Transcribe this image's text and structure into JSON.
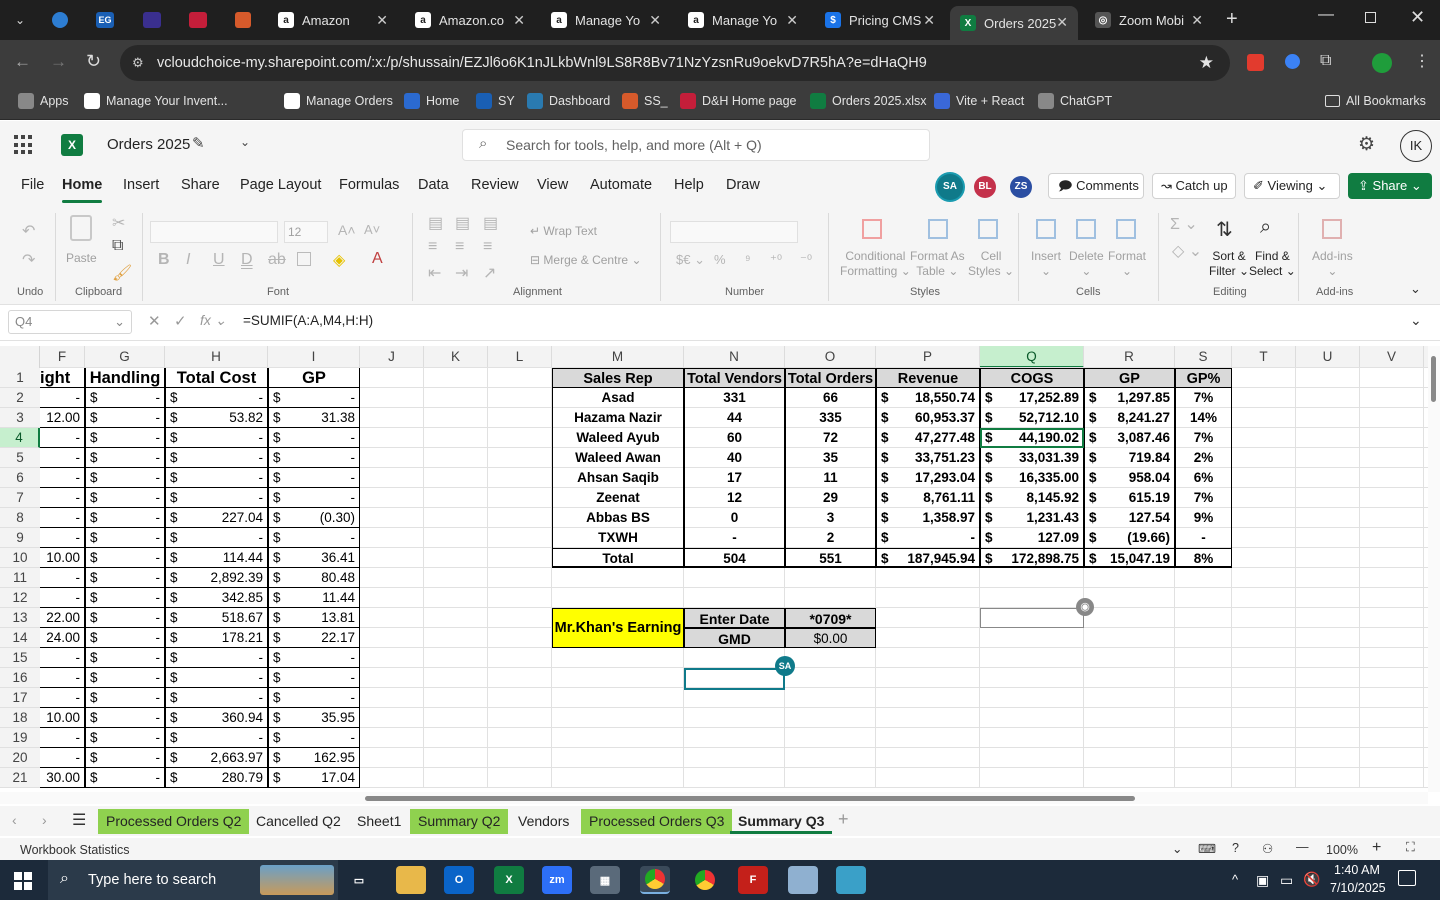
{
  "browser": {
    "tabs": [
      {
        "label": "Amazon",
        "favicon_text": "a",
        "color": "#222"
      },
      {
        "label": "Amazon.co",
        "favicon_text": "a",
        "color": "#222"
      },
      {
        "label": "Manage Yo",
        "favicon_text": "a",
        "color": "#222"
      },
      {
        "label": "Manage Yo",
        "favicon_text": "a",
        "color": "#222"
      },
      {
        "label": "Pricing CMS",
        "favicon_text": "$",
        "color": "#1a73e8"
      },
      {
        "label": "Orders 2025",
        "favicon_text": "X",
        "color": "#107c41"
      },
      {
        "label": "Zoom Mobi",
        "favicon_text": "◎",
        "color": "#555"
      }
    ],
    "url": "vcloudchoice-my.sharepoint.com/:x:/p/shussain/EZJl6o6K1nJLkbWnl9LS8R8Bv71NzYzsnRu9oekvD7R5hA?e=dHaQH9",
    "bookmarks": [
      {
        "label": "Apps"
      },
      {
        "label": "Manage Your Invent..."
      },
      {
        "label": "Manage Orders"
      },
      {
        "label": "Home"
      },
      {
        "label": "SY"
      },
      {
        "label": "Dashboard"
      },
      {
        "label": "SS_"
      },
      {
        "label": "D&H Home page"
      },
      {
        "label": "Orders 2025.xlsx"
      },
      {
        "label": "Vite + React"
      },
      {
        "label": "ChatGPT"
      }
    ],
    "all_bookmarks": "All Bookmarks"
  },
  "excel": {
    "doc_title": "Orders 2025",
    "search_placeholder": "Search for tools, help, and more (Alt + Q)",
    "user_initials": "IK",
    "menu": [
      "File",
      "Home",
      "Insert",
      "Share",
      "Page Layout",
      "Formulas",
      "Data",
      "Review",
      "View",
      "Automate",
      "Help",
      "Draw"
    ],
    "active_menu": "Home",
    "presence": [
      {
        "initials": "SA",
        "color": "#0f7a8a"
      },
      {
        "initials": "BL",
        "color": "#c4314b"
      },
      {
        "initials": "ZS",
        "color": "#2b4ea2"
      }
    ],
    "comments_label": "Comments",
    "catchup_label": "Catch up",
    "viewing_label": "Viewing",
    "share_label": "Share",
    "ribbon": {
      "undo_label": "Undo",
      "clipboard_label": "Clipboard",
      "paste_label": "Paste",
      "font_label": "Font",
      "font_size": "12",
      "alignment_label": "Alignment",
      "wrap_text": "Wrap Text",
      "merge_centre": "Merge & Centre",
      "number_label": "Number",
      "styles_label": "Styles",
      "conditional_1": "Conditional",
      "conditional_2": "Formatting",
      "format_table_1": "Format As",
      "format_table_2": "Table",
      "cell_styles_1": "Cell",
      "cell_styles_2": "Styles",
      "cells_label": "Cells",
      "insert": "Insert",
      "delete": "Delete",
      "format": "Format",
      "editing_label": "Editing",
      "sort_1": "Sort &",
      "sort_2": "Filter",
      "find_1": "Find &",
      "find_2": "Select",
      "addins": "Add-ins",
      "addins_label": "Add-ins"
    },
    "name_box": "Q4",
    "formula": "=SUMIF(A:A,M4,H:H)",
    "columns": [
      {
        "name": "F",
        "w": 45
      },
      {
        "name": "G",
        "w": 80
      },
      {
        "name": "H",
        "w": 103
      },
      {
        "name": "I",
        "w": 92
      },
      {
        "name": "J",
        "w": 64
      },
      {
        "name": "K",
        "w": 64
      },
      {
        "name": "L",
        "w": 64
      },
      {
        "name": "M",
        "w": 132
      },
      {
        "name": "N",
        "w": 101
      },
      {
        "name": "O",
        "w": 91
      },
      {
        "name": "P",
        "w": 104
      },
      {
        "name": "Q",
        "w": 104
      },
      {
        "name": "R",
        "w": 91
      },
      {
        "name": "S",
        "w": 57
      },
      {
        "name": "T",
        "w": 64
      },
      {
        "name": "U",
        "w": 64
      },
      {
        "name": "V",
        "w": 64
      }
    ],
    "rows": [
      "1",
      "2",
      "3",
      "4",
      "5",
      "6",
      "7",
      "8",
      "9",
      "10",
      "11",
      "12",
      "13",
      "14",
      "15",
      "16",
      "17",
      "18",
      "19",
      "20",
      "21"
    ],
    "left_headers": [
      "ight",
      "Handling",
      "Total Cost",
      "GP"
    ],
    "left_data": [
      [
        "-",
        "-",
        "-",
        "-"
      ],
      [
        "12.00",
        "-",
        "53.82",
        "31.38"
      ],
      [
        "-",
        "-",
        "-",
        "-"
      ],
      [
        "-",
        "-",
        "-",
        "-"
      ],
      [
        "-",
        "-",
        "-",
        "-"
      ],
      [
        "-",
        "-",
        "-",
        "-"
      ],
      [
        "-",
        "-",
        "227.04",
        "(0.30)"
      ],
      [
        "-",
        "-",
        "-",
        "-"
      ],
      [
        "10.00",
        "-",
        "114.44",
        "36.41"
      ],
      [
        "-",
        "-",
        "2,892.39",
        "80.48"
      ],
      [
        "-",
        "-",
        "342.85",
        "11.44"
      ],
      [
        "22.00",
        "-",
        "518.67",
        "13.81"
      ],
      [
        "24.00",
        "-",
        "178.21",
        "22.17"
      ],
      [
        "-",
        "-",
        "-",
        "-"
      ],
      [
        "-",
        "-",
        "-",
        "-"
      ],
      [
        "-",
        "-",
        "-",
        "-"
      ],
      [
        "10.00",
        "-",
        "360.94",
        "35.95"
      ],
      [
        "-",
        "-",
        "-",
        "-"
      ],
      [
        "-",
        "-",
        "2,663.97",
        "162.95"
      ],
      [
        "30.00",
        "-",
        "280.79",
        "17.04"
      ]
    ],
    "summary_headers": [
      "Sales Rep",
      "Total Vendors",
      "Total Orders",
      "Revenue",
      "COGS",
      "GP",
      "GP%"
    ],
    "summary_rows": [
      [
        "Asad",
        "331",
        "66",
        "18,550.74",
        "17,252.89",
        "1,297.85",
        "7%"
      ],
      [
        "Hazama Nazir",
        "44",
        "335",
        "60,953.37",
        "52,712.10",
        "8,241.27",
        "14%"
      ],
      [
        "Waleed Ayub",
        "60",
        "72",
        "47,277.48",
        "44,190.02",
        "3,087.46",
        "7%"
      ],
      [
        "Waleed Awan",
        "40",
        "35",
        "33,751.23",
        "33,031.39",
        "719.84",
        "2%"
      ],
      [
        "Ahsan Saqib",
        "17",
        "11",
        "17,293.04",
        "16,335.00",
        "958.04",
        "6%"
      ],
      [
        "Zeenat",
        "12",
        "29",
        "8,761.11",
        "8,145.92",
        "615.19",
        "7%"
      ],
      [
        "Abbas BS",
        "0",
        "3",
        "1,358.97",
        "1,231.43",
        "127.54",
        "9%"
      ],
      [
        "TXWH",
        "-",
        "2",
        "-",
        "127.09",
        "(19.66)",
        "-"
      ]
    ],
    "summary_total": [
      "Total",
      "504",
      "551",
      "187,945.94",
      "172,898.75",
      "15,047.19",
      "8%"
    ],
    "currency": "$",
    "khan": {
      "label": "Mr.Khan's Earning",
      "enter_date": "Enter Date",
      "date_value": "*0709*",
      "gmd": "GMD",
      "gmd_value": "$0.00"
    },
    "cursor_badges": [
      {
        "initials": "SA"
      }
    ],
    "sheets": [
      {
        "label": "Processed Orders Q2",
        "color": "#8fd14f"
      },
      {
        "label": "Cancelled Q2",
        "color": ""
      },
      {
        "label": "Sheet1",
        "color": ""
      },
      {
        "label": "Summary Q2",
        "color": "#8fd14f"
      },
      {
        "label": "Vendors",
        "color": ""
      },
      {
        "label": "Processed Orders Q3",
        "color": "#8fd14f"
      },
      {
        "label": "Summary Q3",
        "color": "",
        "active": true
      }
    ],
    "status_left": "Workbook Statistics",
    "zoom": "100%"
  },
  "taskbar": {
    "search_placeholder": "Type here to search",
    "time": "1:40 AM",
    "date": "7/10/2025"
  },
  "colors": {
    "excel_green": "#107c41",
    "selected_col": "#c6efce",
    "yellow": "#ffff00",
    "gray_header": "#d9d9d9"
  }
}
